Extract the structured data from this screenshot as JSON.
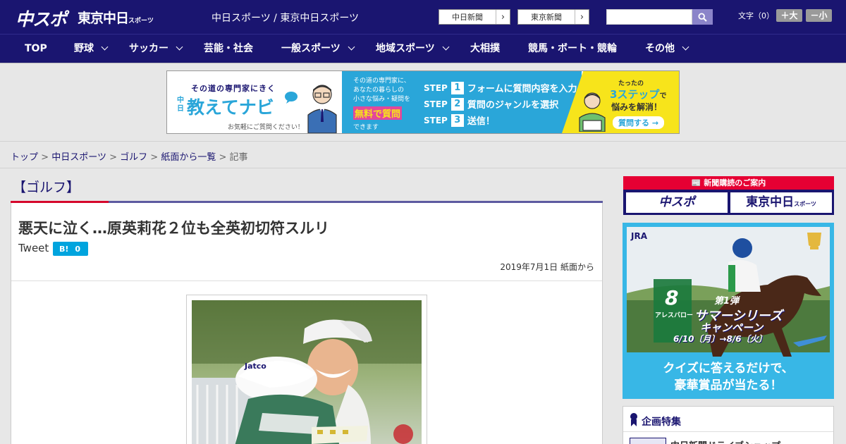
{
  "header": {
    "logo_main": "中スポ",
    "logo_tokyo": "東京中日",
    "logo_tokyo_sub": "スポーツ",
    "site_links": "中日スポーツ / 東京中日スポーツ",
    "paper_buttons": [
      "中日新聞",
      "東京新聞"
    ],
    "search_placeholder": "",
    "font_size_label": "文字（0）",
    "font_plus": "＋大",
    "font_minus": "－小"
  },
  "nav": {
    "items": [
      {
        "label": "TOP"
      },
      {
        "label": "野球"
      },
      {
        "label": "サッカー"
      },
      {
        "label": "芸能・社会"
      },
      {
        "label": "一般スポーツ"
      },
      {
        "label": "地域スポーツ"
      },
      {
        "label": "大相撲"
      },
      {
        "label": "競馬・ボート・競輪"
      },
      {
        "label": "その他"
      }
    ]
  },
  "banner": {
    "left_caption": "その道の専門家にきく",
    "left_brand_small": "中日",
    "left_brand": "教えてナビ",
    "left_note": "お気軽にご質問ください！",
    "mid_lines": [
      "その道の専門家に、",
      "あなたの暮らしの",
      "小さな悩み・疑問を"
    ],
    "mid_highlight": "無料で質問",
    "mid_tail": "できます",
    "steps": [
      {
        "num": "1",
        "text": "フォームに質問内容を入力"
      },
      {
        "num": "2",
        "text": "質問のジャンルを選択"
      },
      {
        "num": "3",
        "text": "送信！"
      }
    ],
    "step_word": "STEP",
    "right_top": "たったの",
    "right_big": "3ステップ",
    "right_de": "で",
    "right_sub": "悩みを解消！",
    "right_btn": "質問する"
  },
  "breadcrumb": {
    "items": [
      "トップ",
      "中日スポーツ",
      "ゴルフ",
      "紙面から一覧"
    ],
    "current": "記事",
    "sep": ">"
  },
  "article": {
    "category": "【ゴルフ】",
    "headline": "悪天に泣く…原英莉花２位も全英初切符スルリ",
    "tweet": "Tweet",
    "hatena_b": "B!",
    "hatena_count": "0",
    "dateline": "2019年7月1日 紙面から"
  },
  "sidebar": {
    "subscription_header": "新聞購読のご案内",
    "sub_logos": [
      "中スポ",
      "東京中日"
    ],
    "sub_logo_small": "スポーツ",
    "jra": {
      "logo": "JRA",
      "series_no": "第1弾",
      "series_title": "サマーシリーズ",
      "series_sub": "キャンペーン",
      "dates": "6/10〔月〕→8/6〔火〕",
      "horse_num": "8",
      "horse_name": "アレスバロー",
      "cta_line1": "クイズに答えるだけで、",
      "cta_line2": "豪華賞品が当たる！"
    },
    "feature_title": "企画特集",
    "feature_item": "中日新聞ドライブショップ"
  },
  "colors": {
    "brand_navy": "#1a1570",
    "accent_red": "#d6082c",
    "hatena_blue": "#00a4de",
    "jra_blue": "#38b7e6"
  }
}
